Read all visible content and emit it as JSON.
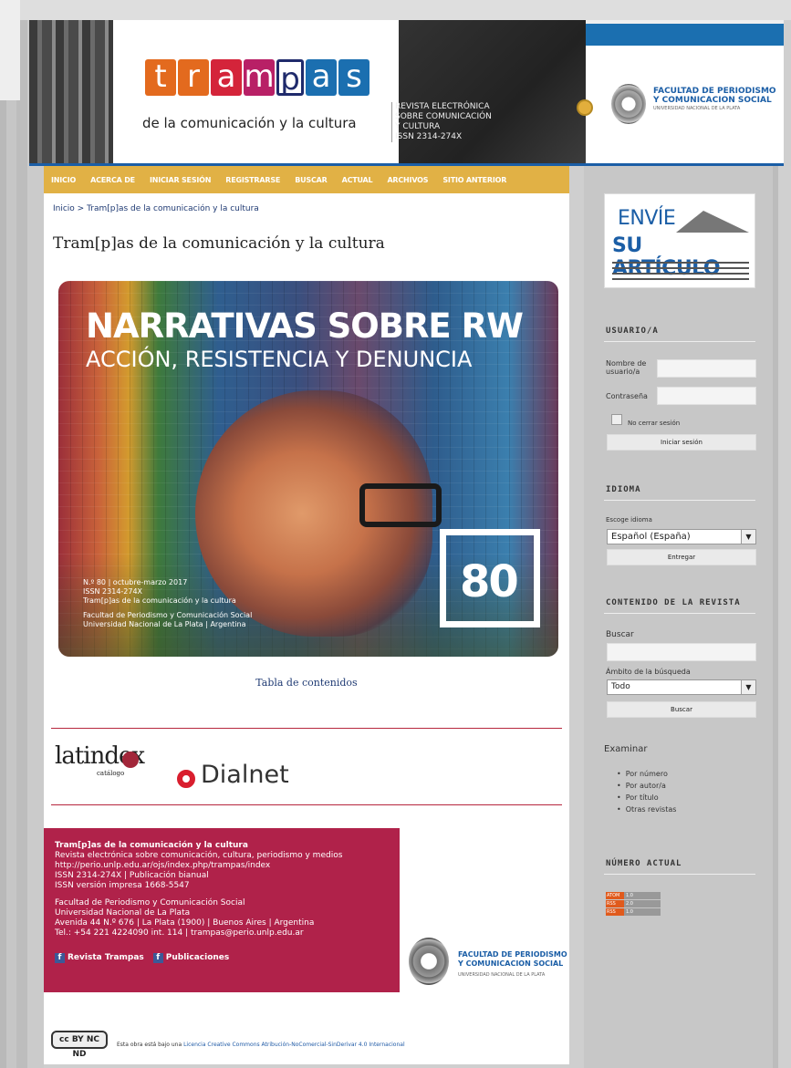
{
  "header": {
    "logo_letters": [
      "t",
      "r",
      "a",
      "m",
      "[p]",
      "a",
      "s"
    ],
    "logo_colors": [
      "#e36a1e",
      "#e36a1e",
      "#d4243a",
      "#b82066",
      "#1f2a6b",
      "#1b6fb0",
      "#1b6fb0"
    ],
    "logo_subtitle": "de la comunicación y la cultura",
    "desc": [
      "REVISTA ELECTRÓNICA",
      "SOBRE COMUNICACIÓN",
      "Y CULTURA",
      "ISSN 2314-274X"
    ],
    "faculty": [
      "FACULTAD DE PERIODISMO",
      "Y COMUNICACION SOCIAL"
    ],
    "faculty_sub": "UNIVERSIDAD NACIONAL DE LA PLATA"
  },
  "nav": [
    "INICIO",
    "ACERCA DE",
    "INICIAR SESIÓN",
    "REGISTRARSE",
    "BUSCAR",
    "ACTUAL",
    "ARCHIVOS",
    "SITIO ANTERIOR"
  ],
  "main": {
    "breadcrumb": "Inicio > Tram[p]as de la comunicación y la cultura",
    "title": "Tram[p]as de la comunicación y la cultura",
    "cover": {
      "title": "NARRATIVAS SOBRE RW",
      "subtitle": "ACCIÓN, RESISTENCIA Y DENUNCIA",
      "meta": [
        "N.º 80 | octubre-marzo 2017",
        "ISSN 2314-274X",
        "Tram[p]as de la comunicación y la cultura",
        "",
        "Facultad de Periodismo y Comunicación Social",
        "Universidad Nacional de La Plata | Argentina"
      ],
      "number": "80"
    },
    "toc_link": "Tabla de contenidos"
  },
  "footer": {
    "latindex": "latindex",
    "latindex_sub": "catálogo",
    "dialnet": "Dialnet",
    "info": [
      "Tram[p]as de la comunicación y la cultura",
      "Revista electrónica sobre comunicación, cultura, periodismo y medios",
      "http://perio.unlp.edu.ar/ojs/index.php/trampas/index",
      "ISSN 2314-274X | Publicación bianual",
      "ISSN versión impresa 1668-5547",
      "",
      "Facultad de Periodismo y Comunicación Social",
      "Universidad Nacional de La Plata",
      "Avenida 44 N.º 676 | La Plata (1900) | Buenos Aires | Argentina",
      "Tel.: +54 221 4224090 int. 114 | trampas@perio.unlp.edu.ar"
    ],
    "facebook": [
      "Revista Trampas",
      "Publicaciones"
    ],
    "faculty": [
      "FACULTAD DE PERIODISMO",
      "Y COMUNICACION SOCIAL"
    ],
    "faculty_sub": "UNIVERSIDAD NACIONAL DE LA PLATA",
    "cc_badge": "cc BY NC ND",
    "license_prefix": "Esta obra está bajo una ",
    "license_link": "Licencia Creative Commons Atribución-NoComercial-SinDerivar 4.0 Internacional"
  },
  "sidebar": {
    "envie_1": "ENVÍE",
    "envie_2": "SU ARTÍCULO",
    "user_heading": "USUARIO/A",
    "username_label": "Nombre de usuario/a",
    "password_label": "Contraseña",
    "remember_label": "No cerrar sesión",
    "login_button": "Iniciar sesión",
    "lang_heading": "IDIOMA",
    "lang_label": "Escoge idioma",
    "lang_value": "Español (España)",
    "lang_submit": "Entregar",
    "content_heading": "CONTENIDO DE LA REVISTA",
    "search_label": "Buscar",
    "scope_label": "Ámbito de la búsqueda",
    "scope_value": "Todo",
    "search_button": "Buscar",
    "browse_label": "Examinar",
    "browse_items": [
      "Por número",
      "Por autor/a",
      "Por título",
      "Otras revistas"
    ],
    "current_heading": "NÚMERO ACTUAL",
    "feeds": [
      [
        "ATOM",
        "1.0"
      ],
      [
        "RSS",
        "2.0"
      ],
      [
        "RSS",
        "1.0"
      ]
    ]
  }
}
